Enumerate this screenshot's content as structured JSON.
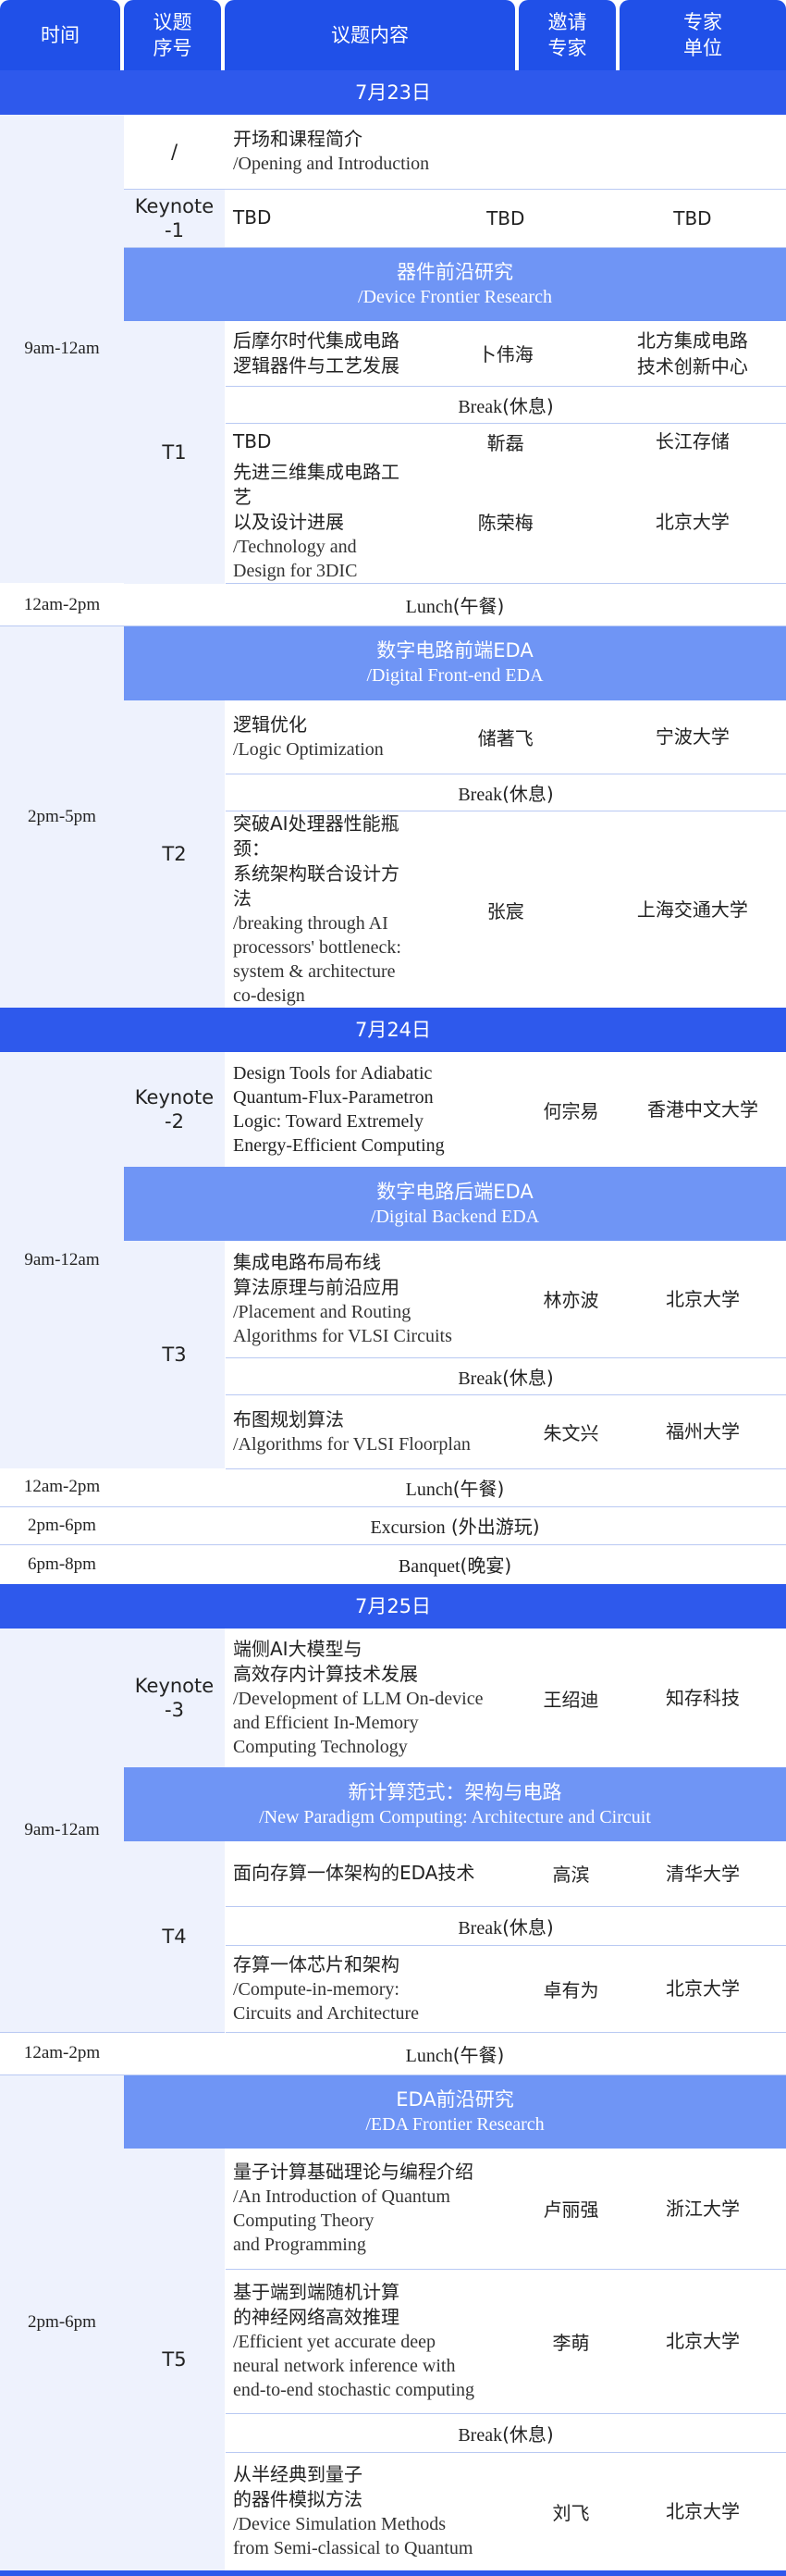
{
  "header": {
    "time": "时间",
    "num": "议题\n序号",
    "content": "议题内容",
    "expert": "邀请\n专家",
    "unit": "专家\n单位"
  },
  "day1": {
    "date": "7月23日",
    "slot1_time": "9am-12am",
    "intro_num": "/",
    "intro_cn": "开场和课程简介",
    "intro_en": "/Opening and Introduction",
    "k1_num": "Keynote\n-1",
    "k1_topic": "TBD",
    "k1_expert": "TBD",
    "k1_unit": "TBD",
    "s1_cn": "器件前沿研究",
    "s1_en": "/Device Frontier Research",
    "t1_num": "T1",
    "t1a_cn": "后摩尔时代集成电路\n逻辑器件与工艺发展",
    "t1a_expert": "卜伟海",
    "t1a_unit": "北方集成电路\n技术创新中心",
    "break_en": "Break",
    "break_cn": "(休息)",
    "t1b_topic": "TBD",
    "t1b_expert": "靳磊",
    "t1b_unit": "长江存储",
    "t1c_cn": "先进三维集成电路工艺\n以及设计进展",
    "t1c_en": "/Technology and Design for 3DIC",
    "t1c_expert": "陈荣梅",
    "t1c_unit": "北京大学",
    "lunch_time": "12am-2pm",
    "lunch_en": "Lunch",
    "lunch_cn": "(午餐)",
    "slot2_time": "2pm-5pm",
    "s2_cn": "数字电路前端EDA",
    "s2_en": "/Digital Front-end EDA",
    "t2_num": "T2",
    "t2a_cn": "逻辑优化",
    "t2a_en": "/Logic Optimization",
    "t2a_expert": "储著飞",
    "t2a_unit": "宁波大学",
    "t2b_cn": "突破AI处理器性能瓶颈：\n系统架构联合设计方法",
    "t2b_en": "/breaking through AI\nprocessors' bottleneck:\nsystem & architecture co-design",
    "t2b_expert": "张宸",
    "t2b_unit": "上海交通大学"
  },
  "day2": {
    "date": "7月24日",
    "slot1_time": "9am-12am",
    "k2_num": "Keynote\n-2",
    "k2_en": "Design Tools for Adiabatic\nQuantum-Flux-Parametron\nLogic: Toward Extremely\nEnergy-Efficient Computing",
    "k2_expert": "何宗易",
    "k2_unit": "香港中文大学",
    "s3_cn": "数字电路后端EDA",
    "s3_en": "/Digital Backend EDA",
    "t3_num": "T3",
    "t3a_cn": "集成电路布局布线\n算法原理与前沿应用",
    "t3a_en": "/Placement and Routing\nAlgorithms for VLSI Circuits",
    "t3a_expert": "林亦波",
    "t3a_unit": "北京大学",
    "t3b_cn": "布图规划算法",
    "t3b_en": "/Algorithms for VLSI Floorplan",
    "t3b_expert": "朱文兴",
    "t3b_unit": "福州大学",
    "lunch_time": "12am-2pm",
    "exc_time": "2pm-6pm",
    "exc_en": "Excursion",
    "exc_cn": " (外出游玩)",
    "ban_time": "6pm-8pm",
    "ban_en": "Banquet",
    "ban_cn": "(晚宴)"
  },
  "day3": {
    "date": "7月25日",
    "slot1_time": "9am-12am",
    "k3_num": "Keynote\n-3",
    "k3_cn": "端侧AI大模型与\n高效存内计算技术发展",
    "k3_en": "/Development of LLM On-device\nand Efficient In-Memory\nComputing Technology",
    "k3_expert": "王绍迪",
    "k3_unit": "知存科技",
    "s4_cn": "新计算范式：架构与电路",
    "s4_en": "/New Paradigm Computing: Architecture and Circuit",
    "t4_num": "T4",
    "t4a_cn": "面向存算一体架构的EDA技术",
    "t4a_expert": "高滨",
    "t4a_unit": "清华大学",
    "t4b_cn": "存算一体芯片和架构",
    "t4b_en": "/Compute-in-memory:\nCircuits and Architecture",
    "t4b_expert": "卓有为",
    "t4b_unit": "北京大学",
    "lunch_time": "12am-2pm",
    "slot2_time": "2pm-6pm",
    "s5_cn": "EDA前沿研究",
    "s5_en": "/EDA Frontier Research",
    "t5_num": "T5",
    "t5a_cn": "量子计算基础理论与编程介绍",
    "t5a_en": "/An Introduction of Quantum\nComputing Theory\nand Programming",
    "t5a_expert": "卢丽强",
    "t5a_unit": "浙江大学",
    "t5b_cn": "基于端到端随机计算\n的神经网络高效推理",
    "t5b_en": "/Efficient yet accurate deep\nneural network inference with\nend-to-end stochastic computing",
    "t5b_expert": "李萌",
    "t5b_unit": "北京大学",
    "t5c_cn": "从半经典到量子\n的器件模拟方法",
    "t5c_en": "/Device Simulation Methods\nfrom Semi-classical to Quantum",
    "t5c_expert": "刘飞",
    "t5c_unit": "北京大学"
  }
}
